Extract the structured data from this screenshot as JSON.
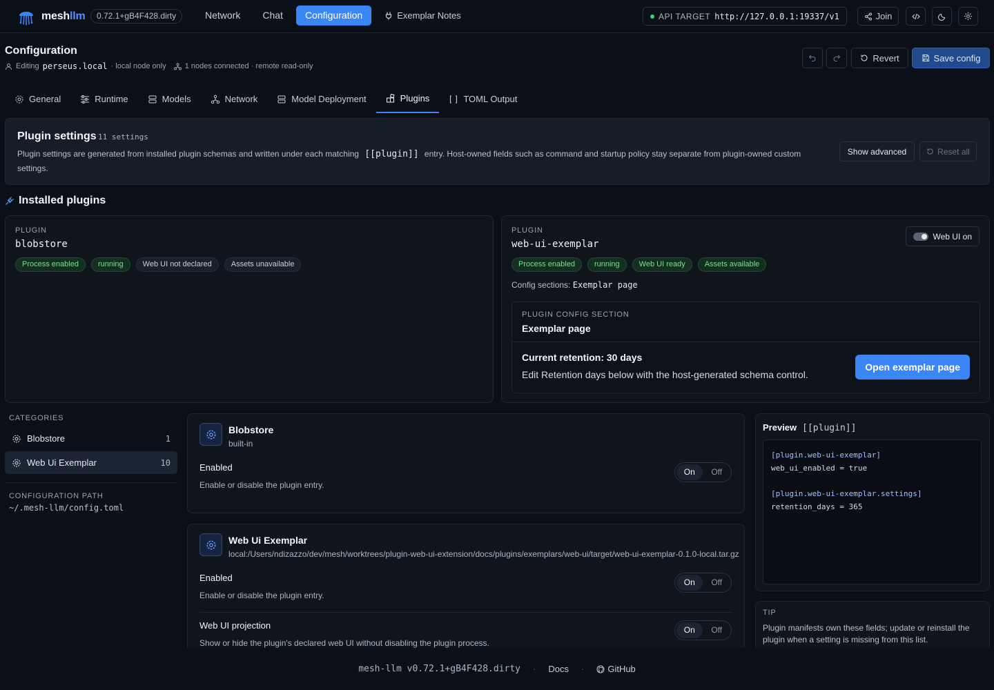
{
  "app": {
    "name_part1": "mesh",
    "name_part2": "llm",
    "version": "0.72.1+gB4F428.dirty"
  },
  "nav": {
    "items": [
      {
        "label": "Network"
      },
      {
        "label": "Chat"
      },
      {
        "label": "Configuration"
      },
      {
        "label": "Exemplar Notes"
      }
    ],
    "api_target_label": "API TARGET",
    "api_target_url": "http://127.0.0.1:19337/v1",
    "join_label": "Join"
  },
  "header": {
    "title": "Configuration",
    "editing_label": "Editing",
    "host": "perseus.local",
    "host_note": "· local node only",
    "nodes_note": "1 nodes connected · remote read-only",
    "revert_label": "Revert",
    "save_label": "Save config"
  },
  "tabs": [
    {
      "label": "General"
    },
    {
      "label": "Runtime"
    },
    {
      "label": "Models"
    },
    {
      "label": "Network"
    },
    {
      "label": "Model Deployment"
    },
    {
      "label": "Plugins"
    },
    {
      "label": "TOML Output"
    }
  ],
  "banner": {
    "title": "Plugin settings",
    "count": "11 settings",
    "desc_before": "Plugin settings are generated from installed plugin schemas and written under each matching",
    "desc_code": "[[plugin]]",
    "desc_after": "entry. Host-owned fields such as command and startup policy stay separate from plugin-owned custom settings.",
    "show_advanced": "Show advanced",
    "reset_all": "Reset all"
  },
  "installed": {
    "title": "Installed plugins",
    "plugins": [
      {
        "label": "PLUGIN",
        "name": "blobstore",
        "badges": [
          "Process enabled",
          "running",
          "Web UI not declared",
          "Assets unavailable"
        ]
      },
      {
        "label": "PLUGIN",
        "name": "web-ui-exemplar",
        "badges": [
          "Process enabled",
          "running",
          "Web UI ready",
          "Assets available"
        ],
        "webui_toggle": "Web UI on",
        "config_sections_label": "Config sections:",
        "config_sections_value": "Exemplar page",
        "section": {
          "label": "PLUGIN CONFIG SECTION",
          "name": "Exemplar page",
          "retention": "Current retention: 30 days",
          "retention_desc": "Edit Retention days below with the host-generated schema control.",
          "open_button": "Open exemplar page"
        }
      }
    ]
  },
  "categories": {
    "label": "CATEGORIES",
    "items": [
      {
        "label": "Blobstore",
        "count": "1"
      },
      {
        "label": "Web Ui Exemplar",
        "count": "10"
      }
    ],
    "config_path_label": "CONFIGURATION PATH",
    "config_path": "~/.mesh-llm/config.toml"
  },
  "settings": {
    "cards": [
      {
        "title": "Blobstore",
        "subtitle": "built-in",
        "fields": [
          {
            "name": "Enabled",
            "desc": "Enable or disable the plugin entry.",
            "on": "On",
            "off": "Off",
            "value": "on"
          }
        ]
      },
      {
        "title": "Web Ui Exemplar",
        "subtitle": "local:/Users/ndizazzo/dev/mesh/worktrees/plugin-web-ui-extension/docs/plugins/exemplars/web-ui/target/web-ui-exemplar-0.1.0-local.tar.gz",
        "fields": [
          {
            "name": "Enabled",
            "desc": "Enable or disable the plugin entry.",
            "on": "On",
            "off": "Off",
            "value": "on"
          },
          {
            "name": "Web UI projection",
            "desc": "Show or hide the plugin's declared web UI without disabling the plugin process.",
            "on": "On",
            "off": "Off",
            "value": "on"
          }
        ]
      }
    ]
  },
  "preview": {
    "title": "Preview",
    "title_code": "[[plugin]]",
    "lines": [
      "[plugin.web-ui-exemplar]",
      "web_ui_enabled = true",
      "",
      "[plugin.web-ui-exemplar.settings]",
      "retention_days = 365"
    ]
  },
  "tip": {
    "label": "TIP",
    "text": "Plugin manifests own these fields; update or reinstall the plugin when a setting is missing from this list."
  },
  "footer": {
    "version": "mesh-llm v0.72.1+gB4F428.dirty",
    "docs": "Docs",
    "github": "GitHub"
  },
  "colors": {
    "accent": "#3b86f6",
    "success": "#7fdc9b",
    "background": "#0b0f17"
  }
}
